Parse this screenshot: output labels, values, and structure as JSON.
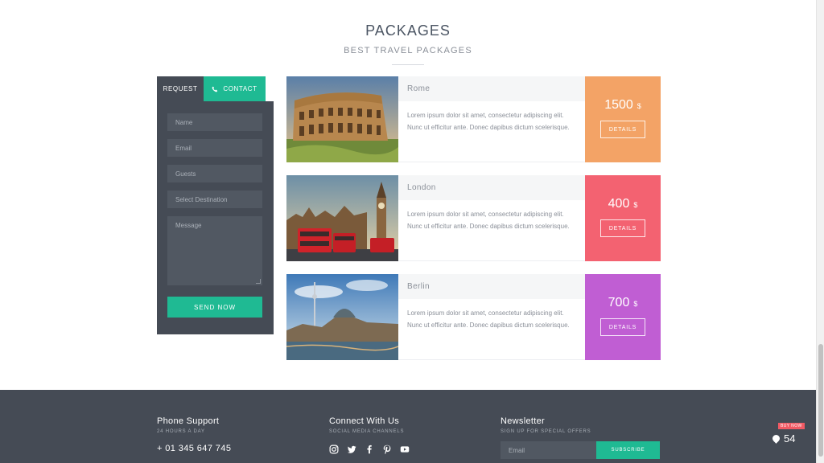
{
  "section": {
    "title": "PACKAGES",
    "subtitle": "BEST TRAVEL PACKAGES"
  },
  "booking": {
    "tabs": [
      {
        "label": "REQUEST"
      },
      {
        "label": "CONTACT",
        "icon": "phone-icon"
      }
    ],
    "fields": {
      "name": "Name",
      "email": "Email",
      "guests": "Guests",
      "destination": "Select Destination",
      "message": "Message"
    },
    "send_label": "SEND NOW"
  },
  "packages": [
    {
      "name": "Rome",
      "description": "Lorem ipsum dolor sit amet, consectetur adipiscing elit. Nunc ut efficitur ante. Donec dapibus dictum scelerisque.",
      "price": "1500",
      "currency": "$",
      "details_label": "DETAILS",
      "color": "#f3a366"
    },
    {
      "name": "London",
      "description": "Lorem ipsum dolor sit amet, consectetur adipiscing elit. Nunc ut efficitur ante. Donec dapibus dictum scelerisque.",
      "price": "400",
      "currency": "$",
      "details_label": "DETAILS",
      "color": "#f36271"
    },
    {
      "name": "Berlin",
      "description": "Lorem ipsum dolor sit amet, consectetur adipiscing elit. Nunc ut efficitur ante. Donec dapibus dictum scelerisque.",
      "price": "700",
      "currency": "$",
      "details_label": "DETAILS",
      "color": "#c05ed3"
    }
  ],
  "footer": {
    "phone": {
      "title": "Phone Support",
      "subtitle": "24 HOURS A DAY",
      "number": "+ 01 345 647 745"
    },
    "connect": {
      "title": "Connect With Us",
      "subtitle": "SOCIAL MEDIA CHANNELS",
      "icons": [
        "instagram-icon",
        "twitter-icon",
        "facebook-icon",
        "pinterest-icon",
        "youtube-icon"
      ]
    },
    "newsletter": {
      "title": "Newsletter",
      "subtitle": "SIGN UP FOR SPECIAL OFFERS",
      "placeholder": "Email",
      "button": "SUBSCRIBE"
    }
  },
  "badge": {
    "tag": "BUY NOW",
    "number": "54"
  },
  "colors": {
    "accent": "#1fba93",
    "dark": "#454b55"
  }
}
